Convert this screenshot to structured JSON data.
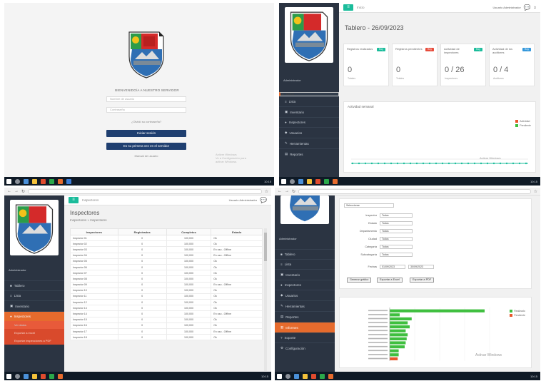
{
  "colors": {
    "sidebar": "#2b3442",
    "accent": "#e66b2d",
    "teal": "#1bbc9b",
    "navy_button": "#1f3f70",
    "taskbar": "#0f1a26"
  },
  "login": {
    "welcome": "BIENVENIDO/A A NUESTRO SERVIDOR",
    "user_placeholder": "Nombre de usuario",
    "password_placeholder": "Contraseña",
    "forgot": "¿Olvidó su contraseña?",
    "login_button": "Iniciar sesión",
    "secondary_button": "Es su primera vez en el servidor",
    "footer_link": "Manual de usuario",
    "activate_windows": [
      "Activar Windows",
      "Ve a Configuración para",
      "activar Windows."
    ]
  },
  "dashboard": {
    "crumb": "Inicio",
    "title": "Tablero - 26/09/2023",
    "user": "Administrador",
    "header_user": "Usuario Administrador",
    "kpis": [
      {
        "label": "Registros realizados",
        "badge": "Hoy",
        "badge_color": "#1bbc9b",
        "value": "0",
        "sub": "Totales"
      },
      {
        "label": "Registros pendientes",
        "badge": "Hoy",
        "badge_color": "#e74c3c",
        "value": "0",
        "sub": "Totales"
      },
      {
        "label": "Actividad de inspectores",
        "badge": "Hoy",
        "badge_color": "#1bbc9b",
        "value": "0 / 26",
        "sub": "Inspectores"
      },
      {
        "label": "Actividad de los auditores",
        "badge": "Hoy",
        "badge_color": "#3498db",
        "value": "0 / 4",
        "sub": "Auditores"
      }
    ],
    "panel_title": "Actividad semanal",
    "legend": [
      "Actividad",
      "Pendiente"
    ],
    "activate_windows": [
      "Activar Windows",
      "Ve a Configuración para activar Windows."
    ]
  },
  "sidebar": {
    "items": [
      "Tablero",
      "Lista",
      "Inventario",
      "Inspectores",
      "Usuarios",
      "Herramientas",
      "Reportes",
      "Informes",
      "Soporte",
      "Configuración"
    ],
    "sub_items": [
      "Ver datos",
      "Exportar a excel",
      "Exportar inspecciones a PDF"
    ]
  },
  "table": {
    "crumb": "Inspectores",
    "title": "Inspectores",
    "subtitle": "Inspectores » Inspectores",
    "columns": [
      "Inspectores",
      "Registrados",
      "Completos",
      "Estado"
    ],
    "rows": [
      [
        "Inspector 01",
        "0",
        "100,000",
        "Ok"
      ],
      [
        "Inspector 02",
        "0",
        "100,000",
        "Ok"
      ],
      [
        "Inspector 03",
        "0",
        "100,000",
        "En uso - Offline"
      ],
      [
        "Inspector 04",
        "0",
        "100,000",
        "En uso - Offline"
      ],
      [
        "Inspector 05",
        "0",
        "100,000",
        "Ok"
      ],
      [
        "Inspector 06",
        "0",
        "100,000",
        "Ok"
      ],
      [
        "Inspector 07",
        "0",
        "100,000",
        "Ok"
      ],
      [
        "Inspector 08",
        "0",
        "100,000",
        "Ok"
      ],
      [
        "Inspector 09",
        "0",
        "100,000",
        "En uso - Offline"
      ],
      [
        "Inspector 10",
        "0",
        "100,000",
        "Ok"
      ],
      [
        "Inspector 11",
        "0",
        "100,000",
        "Ok"
      ],
      [
        "Inspector 12",
        "0",
        "100,000",
        "Ok"
      ],
      [
        "Inspector 13",
        "0",
        "100,000",
        "Ok"
      ],
      [
        "Inspector 14",
        "0",
        "100,000",
        "En uso - Offline"
      ],
      [
        "Inspector 15",
        "0",
        "100,000",
        "Ok"
      ],
      [
        "Inspector 16",
        "0",
        "100,000",
        "Ok"
      ],
      [
        "Inspector 17",
        "0",
        "100,000",
        "En uso - Offline"
      ],
      [
        "Inspector 18",
        "0",
        "100,000",
        "Ok"
      ]
    ]
  },
  "filter_form": {
    "top_select": "Seleccionar",
    "fields": [
      {
        "label": "Inspector",
        "value": "Todos"
      },
      {
        "label": "Estado",
        "value": "Todos"
      },
      {
        "label": "Departamento",
        "value": "Todos"
      },
      {
        "label": "Ciudad",
        "value": "Todos"
      },
      {
        "label": "Categoría",
        "value": "Todos"
      },
      {
        "label": "Subcategoría",
        "value": "Todos"
      }
    ],
    "date_label": "Fechas",
    "date_from": "01/09/2023",
    "date_to": "30/09/2023",
    "buttons": [
      "Generar gráfico",
      "Exportar a Excel",
      "Exportar a PDF"
    ]
  },
  "chart_data": {
    "type": "bar",
    "orientation": "horizontal",
    "title": "",
    "categories": [
      "A",
      "B",
      "C",
      "D",
      "E",
      "F",
      "G",
      "H",
      "I",
      "J",
      "K",
      "L",
      "M"
    ],
    "series": [
      {
        "color": "#3fbf3f",
        "values": [
          95,
          10,
          22,
          18,
          20,
          16,
          18,
          17,
          16,
          15,
          9,
          9,
          0
        ]
      },
      {
        "color": "#e8572b",
        "values": [
          0,
          0,
          0,
          0,
          0,
          0,
          0,
          0,
          0,
          0,
          0,
          0,
          8
        ]
      }
    ],
    "legend": [
      "Realizado",
      "Pendiente"
    ],
    "legend_position": "top-right",
    "grid": true
  },
  "taskbar": {
    "time": "10:15",
    "date": "26/09/2023"
  }
}
